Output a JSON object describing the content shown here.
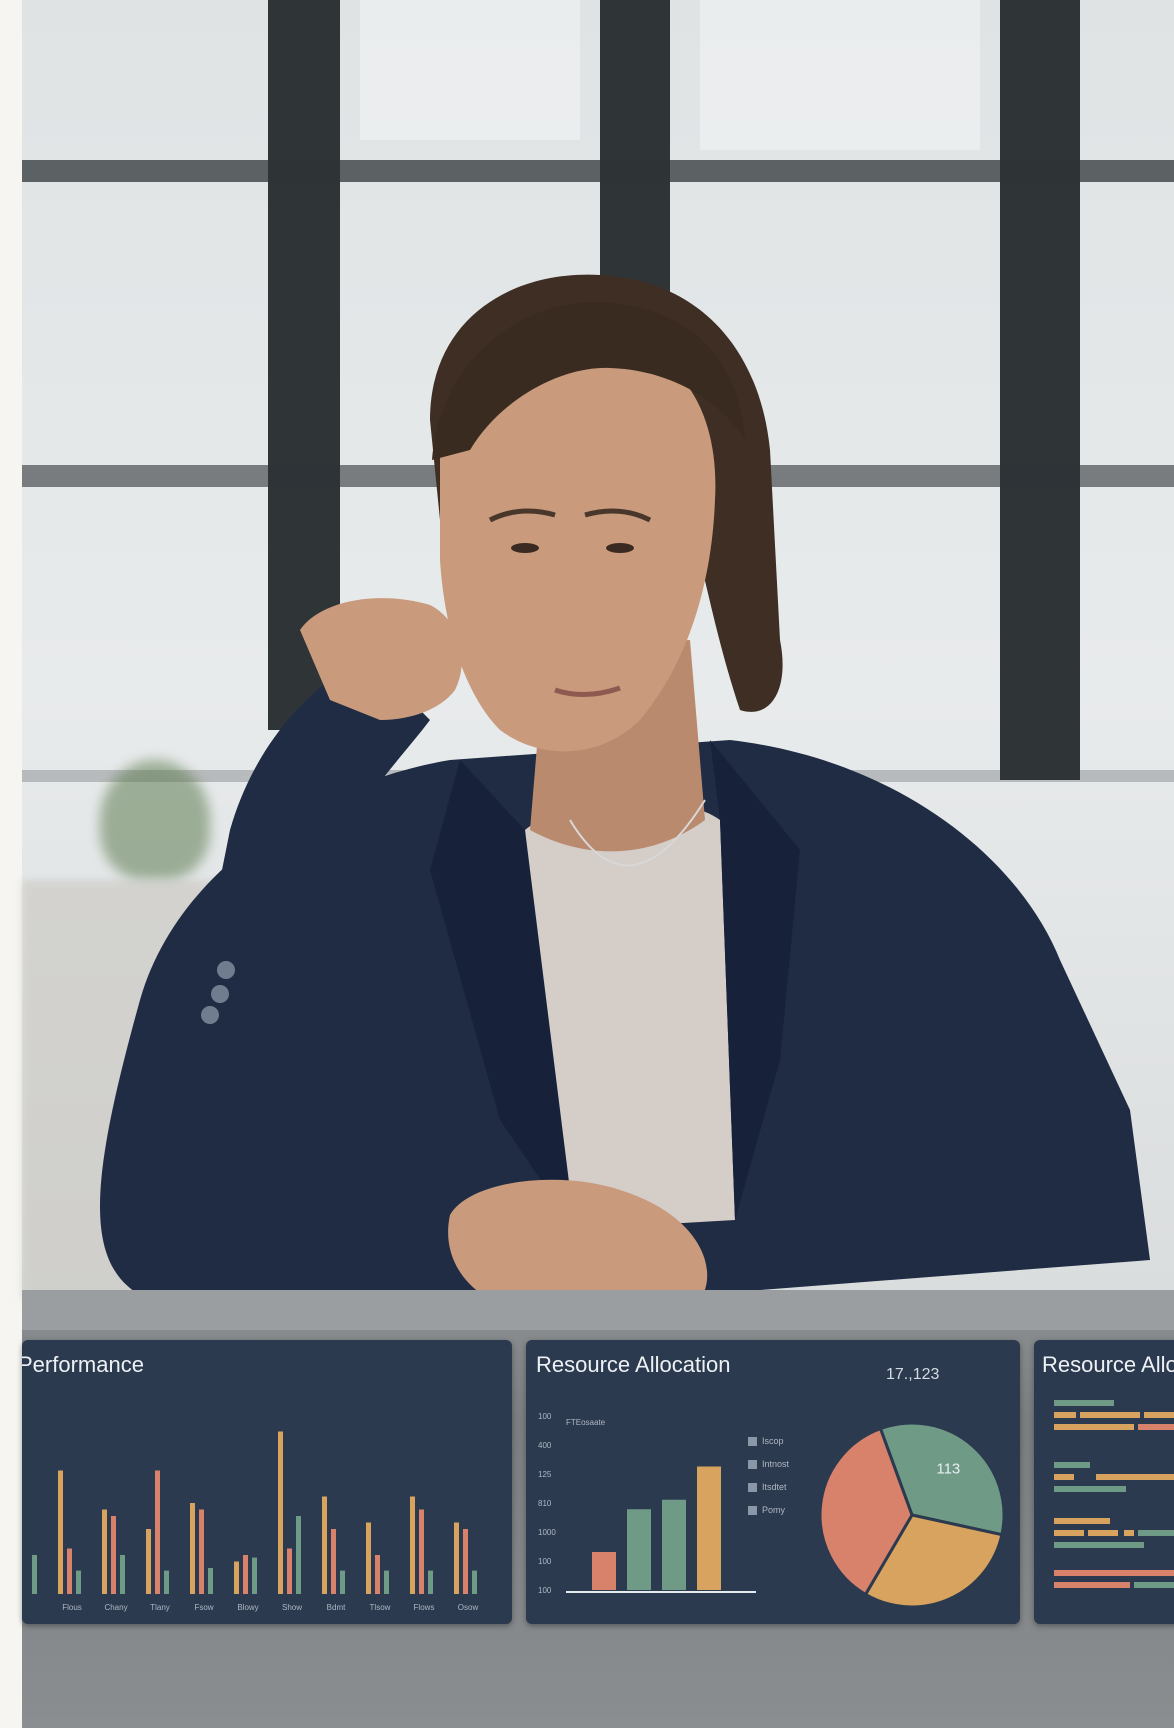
{
  "scene": {
    "colors": {
      "panel": "#2c3a4f",
      "bar_orange": "#d7a35e",
      "bar_salmon": "#d9826b",
      "bar_green": "#6e9a86",
      "blazer": "#1f2c44",
      "top": "#d4cdc8",
      "skin": "#c99a7c",
      "hair": "#3e2e24"
    }
  },
  "panels": {
    "performance": {
      "title": "Performance"
    },
    "resource": {
      "title": "Resource Allocation",
      "value": "17.,123"
    },
    "resource_partial": {
      "title": "Resource Allo"
    }
  },
  "chart_data": [
    {
      "type": "bar",
      "title": "Performance",
      "categories": [
        "",
        "Flous",
        "Chany",
        "Tlany",
        "Fsow",
        "Blowy",
        "Show",
        "Bdmt",
        "Tlsow",
        "Flows",
        "Osow"
      ],
      "series": [
        {
          "values": [
            0,
            95,
            65,
            50,
            70,
            25,
            125,
            75,
            55,
            75,
            55
          ]
        },
        {
          "values": [
            0,
            35,
            60,
            95,
            65,
            30,
            35,
            50,
            30,
            65,
            50
          ]
        },
        {
          "values": [
            30,
            18,
            30,
            18,
            20,
            28,
            60,
            18,
            18,
            18,
            18
          ]
        }
      ]
    },
    {
      "type": "bar",
      "title": "Resource Allocation",
      "ytick_labels": [
        "100",
        "100",
        "1000",
        "810",
        "125",
        "400",
        "100"
      ],
      "corner_label": "FTEosaate",
      "values": [
        40,
        85,
        95,
        130
      ],
      "legend": [
        "Iscop",
        "Intnost",
        "Itsdtet",
        "Pomy"
      ]
    },
    {
      "type": "pie",
      "slices": [
        {
          "label": "113",
          "value": 34
        },
        {
          "value": 30
        },
        {
          "value": 36
        }
      ]
    },
    {
      "type": "bar",
      "title": "Resource Allo",
      "orientation": "horizontal",
      "values": [
        1,
        1,
        1,
        1,
        1,
        1,
        1,
        1,
        1,
        1,
        1,
        1,
        1
      ]
    }
  ]
}
